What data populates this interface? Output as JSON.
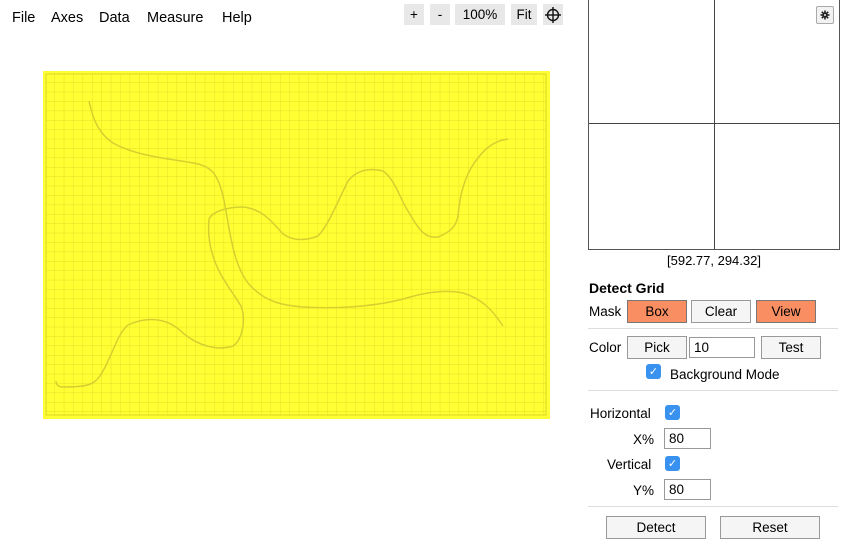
{
  "menu": {
    "file": "File",
    "axes": "Axes",
    "data": "Data",
    "measure": "Measure",
    "help": "Help"
  },
  "zoom": {
    "plus": "+",
    "minus": "-",
    "level": "100%",
    "fit": "Fit"
  },
  "zoom_view": {
    "cursor_coords": "[592.77, 294.32]"
  },
  "detect_grid": {
    "title": "Detect Grid",
    "mask_label": "Mask",
    "box_label": "Box",
    "clear_label": "Clear",
    "view_label": "View",
    "color_label": "Color",
    "pick_label": "Pick",
    "color_value": "10",
    "test_label": "Test",
    "background_mode_label": "Background Mode",
    "background_mode_checked": true,
    "horizontal_label": "Horizontal",
    "horizontal_checked": true,
    "x_percent_label": "X%",
    "x_percent_value": "80",
    "vertical_label": "Vertical",
    "vertical_checked": true,
    "y_percent_label": "Y%",
    "y_percent_value": "80",
    "detect_label": "Detect",
    "reset_label": "Reset"
  },
  "colors": {
    "mask_highlight": "#ffff33",
    "active_button": "#f98e62",
    "checkbox": "#3a92f0",
    "curve": "#d4d030"
  }
}
